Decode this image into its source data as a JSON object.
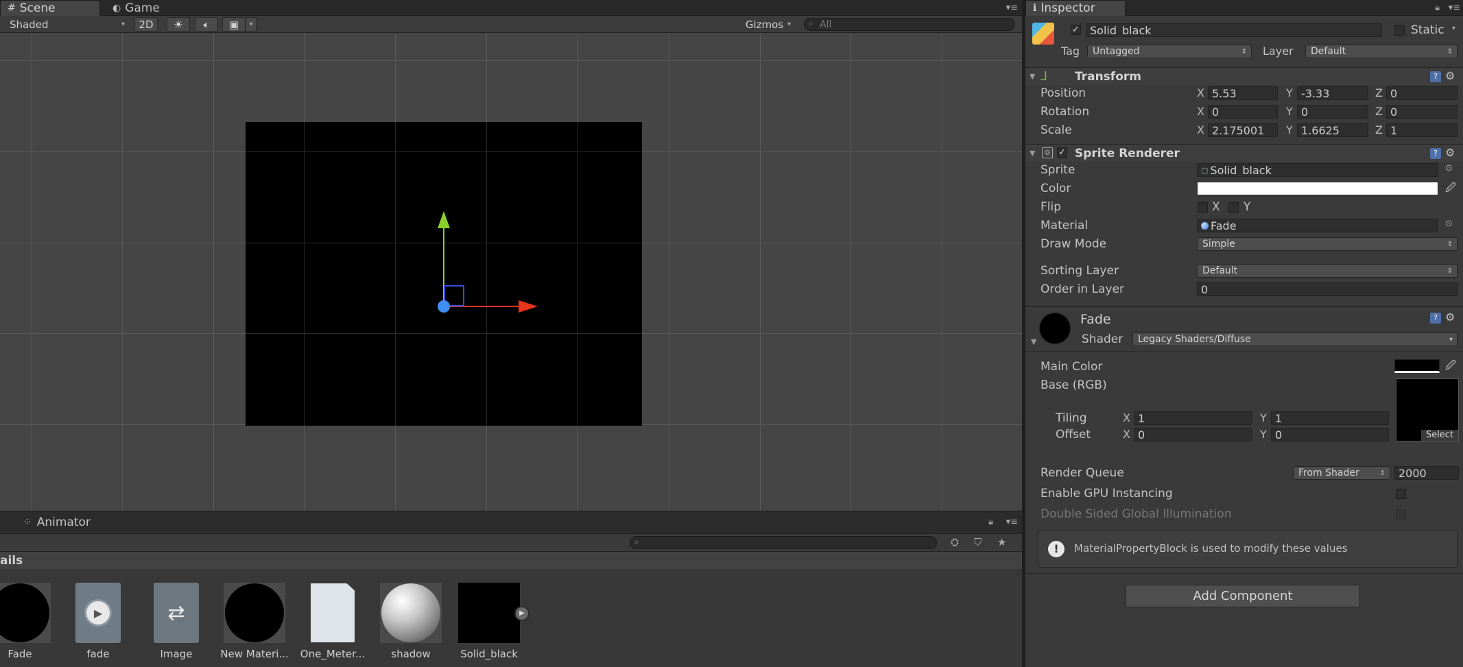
{
  "scene_tabs": {
    "scene": "Scene",
    "game": "Game"
  },
  "scene_toolbar": {
    "shading_mode": "Shaded",
    "mode_2d": "2D",
    "gizmos": "Gizmos",
    "search_placeholder": "All"
  },
  "animator": {
    "tab_label": "Animator"
  },
  "project": {
    "details_header": "ails",
    "assets": [
      {
        "label": "Fade",
        "kind": "circle-black"
      },
      {
        "label": "fade",
        "kind": "animation"
      },
      {
        "label": "Image",
        "kind": "controller"
      },
      {
        "label": "New Materi...",
        "kind": "circle-black"
      },
      {
        "label": "One_Meter...",
        "kind": "page"
      },
      {
        "label": "shadow",
        "kind": "sphere"
      },
      {
        "label": "Solid_black",
        "kind": "square-black"
      }
    ]
  },
  "inspector": {
    "tab_label": "Inspector",
    "object_name": "Solid_black",
    "static_label": "Static",
    "tag_label": "Tag",
    "tag_value": "Untagged",
    "layer_label": "Layer",
    "layer_value": "Default",
    "transform": {
      "title": "Transform",
      "position_label": "Position",
      "rotation_label": "Rotation",
      "scale_label": "Scale",
      "position": {
        "x": "5.53",
        "y": "-3.33",
        "z": "0"
      },
      "rotation": {
        "x": "0",
        "y": "0",
        "z": "0"
      },
      "scale": {
        "x": "2.175001",
        "y": "1.6625",
        "z": "1"
      }
    },
    "sprite_renderer": {
      "title": "Sprite Renderer",
      "sprite_label": "Sprite",
      "sprite_value": "Solid_black",
      "color_label": "Color",
      "flip_label": "Flip",
      "flip_x": "X",
      "flip_y": "Y",
      "material_label": "Material",
      "material_value": "Fade",
      "draw_mode_label": "Draw Mode",
      "draw_mode_value": "Simple",
      "sorting_layer_label": "Sorting Layer",
      "sorting_layer_value": "Default",
      "order_label": "Order in Layer",
      "order_value": "0"
    },
    "material": {
      "name": "Fade",
      "shader_label": "Shader",
      "shader_value": "Legacy Shaders/Diffuse",
      "main_color_label": "Main Color",
      "base_label": "Base (RGB)",
      "tiling_label": "Tiling",
      "offset_label": "Offset",
      "tiling": {
        "x": "1",
        "y": "1"
      },
      "offset": {
        "x": "0",
        "y": "0"
      },
      "select_label": "Select",
      "render_queue_label": "Render Queue",
      "render_queue_mode": "From Shader",
      "render_queue_value": "2000",
      "gpu_instancing_label": "Enable GPU Instancing",
      "double_sided_label": "Double Sided Global Illumination",
      "info_message": "MaterialPropertyBlock is used to modify these values"
    },
    "add_component": "Add Component"
  },
  "colors": {
    "x_axis": "#e8341c",
    "y_axis": "#8ad12a",
    "pivot": "#3d8ef0"
  }
}
